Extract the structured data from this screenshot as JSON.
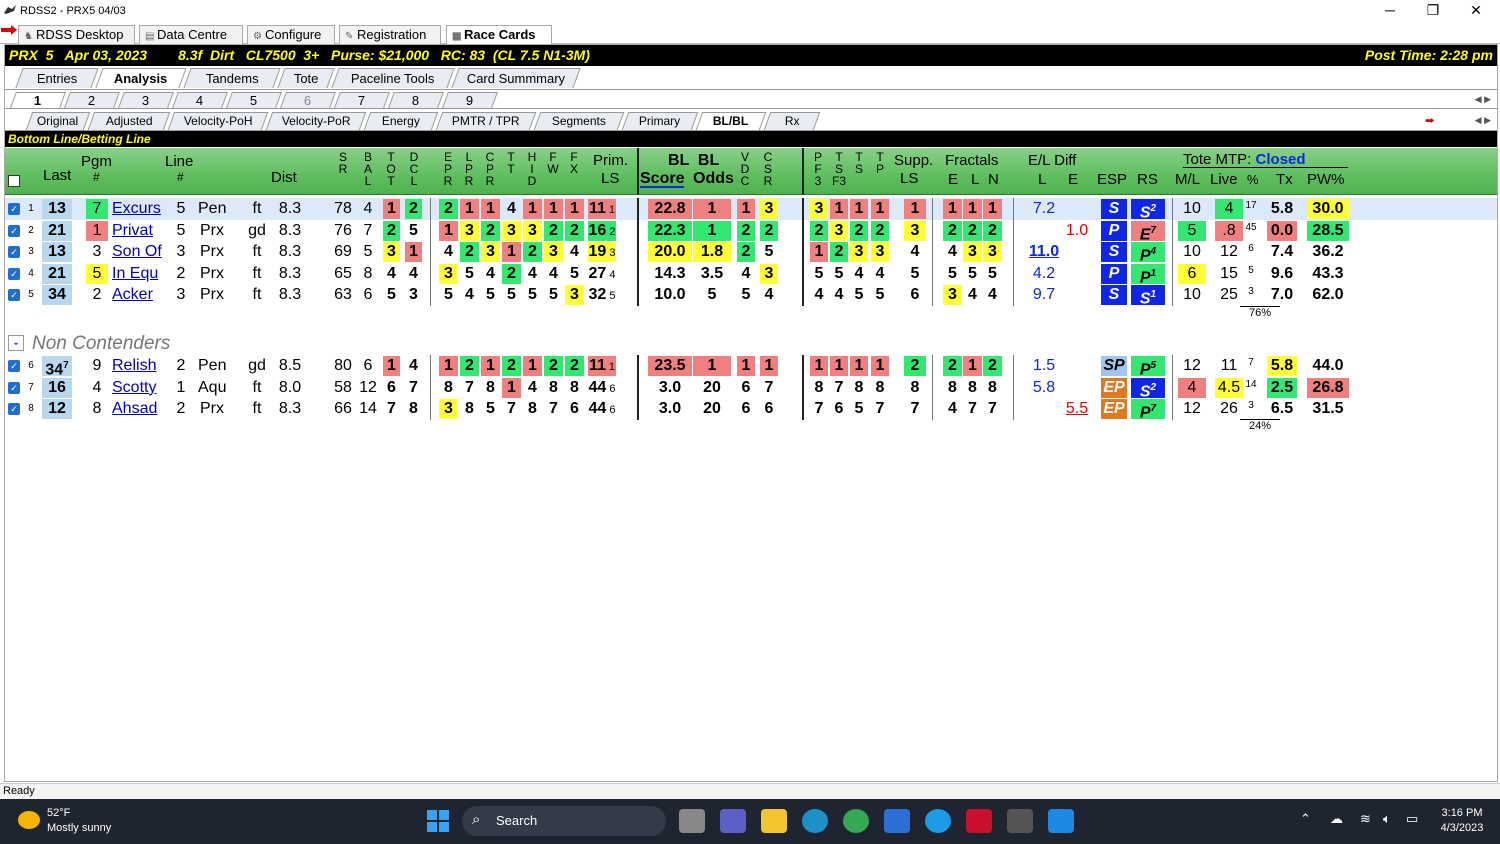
{
  "window": {
    "title": "RDSS2 - PRX5  04/03",
    "min": "─",
    "max": "❐",
    "close": "✕"
  },
  "app_tabs": [
    {
      "label": "RDSS Desktop"
    },
    {
      "label": "Data Centre"
    },
    {
      "label": "Configure"
    },
    {
      "label": "Registration"
    },
    {
      "label": "Race Cards"
    }
  ],
  "race": {
    "info": "PRX  5   Apr 03, 2023        8.3f  Dirt   CL7500  3+   Purse: $21,000   RC: 83  (CL 7.5 N1-3M)",
    "post_time": "Post Time: 2:28 pm"
  },
  "view_tabs": [
    "Entries",
    "Analysis",
    "Tandems",
    "Tote",
    "Paceline Tools",
    "Card Summmary"
  ],
  "race_tabs": [
    "1",
    "2",
    "3",
    "4",
    "5",
    "6",
    "7",
    "8",
    "9"
  ],
  "sub_tabs": [
    "Original",
    "Adjusted",
    "Velocity-PoH",
    "Velocity-PoR",
    "Energy",
    "PMTR / TPR",
    "Segments",
    "Primary",
    "BL/BL",
    "Rx"
  ],
  "section_title": "Bottom Line/Betting Line",
  "headers": {
    "last": "Last",
    "pgm": "Pgm",
    "pgm2": "#",
    "line": "Line",
    "line2": "#",
    "dist": "Dist",
    "prim": "Prim.",
    "ls": "LS",
    "bl": "BL  BL",
    "score": "Score",
    "odds": "Odds",
    "supp": "Supp.",
    "supp_ls": "LS",
    "fractals": "Fractals",
    "e": "E",
    "l": "L",
    "n": "N",
    "eldiff": "E/L Diff",
    "el_l": "L",
    "el_e": "E",
    "esp": "ESP",
    "rs": "RS",
    "tote": "Tote MTP:",
    "tote_status": "Closed",
    "ml": "M/L",
    "live": "Live",
    "pct": "%",
    "tx": "Tx",
    "pw": "PW%"
  },
  "contenders": [
    {
      "n": "1",
      "last": "13",
      "pgm": "7",
      "name": "Excurs",
      "line": "5",
      "trk": "Pen",
      "cond": "ft",
      "dist": "8.3",
      "sr": "78",
      "bal": "4",
      "tot": "1",
      "dcl": "2",
      "epr": "2",
      "lpr": "1",
      "cpr": "1",
      "tt": "4",
      "hid": "1",
      "fw": "1",
      "fx": "1",
      "prim": "11",
      "prim_s": "1",
      "score": "22.8",
      "odds": "1",
      "vdc": "1",
      "csr": "3",
      "pf3": "3",
      "tsf3": "1",
      "ts": "1",
      "tp": "1",
      "supp": "1",
      "fe": "1",
      "fl": "1",
      "fn": "1",
      "dl": "7.2",
      "de": "",
      "esp": "S",
      "rs": "S",
      "rs_s": "2",
      "ml": "10",
      "live": "4",
      "pct": "17",
      "tx": "5.8",
      "pw": "30.0"
    },
    {
      "n": "2",
      "last": "21",
      "pgm": "1",
      "name": "Privat",
      "line": "5",
      "trk": "Prx",
      "cond": "gd",
      "dist": "8.3",
      "sr": "76",
      "bal": "7",
      "tot": "2",
      "dcl": "5",
      "epr": "1",
      "lpr": "3",
      "cpr": "2",
      "tt": "3",
      "hid": "3",
      "fw": "2",
      "fx": "2",
      "prim": "16",
      "prim_s": "2",
      "score": "22.3",
      "odds": "1",
      "vdc": "2",
      "csr": "2",
      "pf3": "2",
      "tsf3": "3",
      "ts": "2",
      "tp": "2",
      "supp": "3",
      "fe": "2",
      "fl": "2",
      "fn": "2",
      "dl": "",
      "de": "1.0",
      "esp": "P",
      "rs": "E",
      "rs_s": "7",
      "ml": "5",
      "live": ".8",
      "pct": "45",
      "tx": "0.0",
      "pw": "28.5"
    },
    {
      "n": "3",
      "last": "13",
      "pgm": "3",
      "name": "Son Of",
      "line": "3",
      "trk": "Prx",
      "cond": "ft",
      "dist": "8.3",
      "sr": "69",
      "bal": "5",
      "tot": "3",
      "dcl": "1",
      "epr": "4",
      "lpr": "2",
      "cpr": "3",
      "tt": "1",
      "hid": "2",
      "fw": "3",
      "fx": "4",
      "prim": "19",
      "prim_s": "3",
      "score": "20.0",
      "odds": "1.8",
      "vdc": "2",
      "csr": "5",
      "pf3": "1",
      "tsf3": "2",
      "ts": "3",
      "tp": "3",
      "supp": "4",
      "fe": "4",
      "fl": "3",
      "fn": "3",
      "dl": "11.0",
      "de": "",
      "esp": "S",
      "rs": "P",
      "rs_s": "4",
      "ml": "10",
      "live": "12",
      "pct": "6",
      "tx": "7.4",
      "pw": "36.2"
    },
    {
      "n": "4",
      "last": "21",
      "pgm": "5",
      "name": "In Equ",
      "line": "2",
      "trk": "Prx",
      "cond": "ft",
      "dist": "8.3",
      "sr": "65",
      "bal": "8",
      "tot": "4",
      "dcl": "4",
      "epr": "3",
      "lpr": "5",
      "cpr": "4",
      "tt": "2",
      "hid": "4",
      "fw": "4",
      "fx": "5",
      "prim": "27",
      "prim_s": "4",
      "score": "14.3",
      "odds": "3.5",
      "vdc": "4",
      "csr": "3",
      "pf3": "5",
      "tsf3": "5",
      "ts": "4",
      "tp": "4",
      "supp": "5",
      "fe": "5",
      "fl": "5",
      "fn": "5",
      "dl": "4.2",
      "de": "",
      "esp": "P",
      "rs": "P",
      "rs_s": "1",
      "ml": "6",
      "live": "15",
      "pct": "5",
      "tx": "9.6",
      "pw": "43.3"
    },
    {
      "n": "5",
      "last": "34",
      "pgm": "2",
      "name": "Acker",
      "line": "3",
      "trk": "Prx",
      "cond": "ft",
      "dist": "8.3",
      "sr": "63",
      "bal": "6",
      "tot": "5",
      "dcl": "3",
      "epr": "5",
      "lpr": "4",
      "cpr": "5",
      "tt": "5",
      "hid": "5",
      "fw": "5",
      "fx": "3",
      "prim": "32",
      "prim_s": "5",
      "score": "10.0",
      "odds": "5",
      "vdc": "5",
      "csr": "4",
      "pf3": "4",
      "tsf3": "4",
      "ts": "5",
      "tp": "5",
      "supp": "6",
      "fe": "3",
      "fl": "4",
      "fn": "4",
      "dl": "9.7",
      "de": "",
      "esp": "S",
      "rs": "S",
      "rs_s": "1",
      "ml": "10",
      "live": "25",
      "pct": "3",
      "tx": "7.0",
      "pw": "62.0"
    }
  ],
  "contenders_total": "76%",
  "non_contenders_label": "Non Contenders",
  "non_contenders_btn": "-",
  "non_contenders": [
    {
      "n": "6",
      "last": "34",
      "last_s": "7",
      "pgm": "9",
      "name": "Relish",
      "line": "2",
      "trk": "Pen",
      "cond": "gd",
      "dist": "8.5",
      "sr": "80",
      "bal": "6",
      "tot": "1",
      "dcl": "4",
      "epr": "1",
      "lpr": "2",
      "cpr": "1",
      "tt": "2",
      "hid": "1",
      "fw": "2",
      "fx": "2",
      "prim": "11",
      "prim_s": "1",
      "score": "23.5",
      "odds": "1",
      "vdc": "1",
      "csr": "1",
      "pf3": "1",
      "tsf3": "1",
      "ts": "1",
      "tp": "1",
      "supp": "2",
      "fe": "2",
      "fl": "1",
      "fn": "2",
      "dl": "1.5",
      "de": "",
      "esp": "SP",
      "rs": "P",
      "rs_s": "5",
      "ml": "12",
      "live": "11",
      "pct": "7",
      "tx": "5.8",
      "pw": "44.0"
    },
    {
      "n": "7",
      "last": "16",
      "last_s": "",
      "pgm": "4",
      "name": "Scotty",
      "line": "1",
      "trk": "Aqu",
      "cond": "ft",
      "dist": "8.0",
      "sr": "58",
      "bal": "12",
      "tot": "6",
      "dcl": "7",
      "epr": "8",
      "lpr": "7",
      "cpr": "8",
      "tt": "1",
      "hid": "4",
      "fw": "8",
      "fx": "8",
      "prim": "44",
      "prim_s": "6",
      "score": "3.0",
      "odds": "20",
      "vdc": "6",
      "csr": "7",
      "pf3": "8",
      "tsf3": "7",
      "ts": "8",
      "tp": "8",
      "supp": "8",
      "fe": "8",
      "fl": "8",
      "fn": "8",
      "dl": "5.8",
      "de": "",
      "esp": "EP",
      "rs": "S",
      "rs_s": "2",
      "ml": "4",
      "live": "4.5",
      "pct": "14",
      "tx": "2.5",
      "pw": "26.8"
    },
    {
      "n": "8",
      "last": "12",
      "last_s": "",
      "pgm": "8",
      "name": "Ahsad",
      "line": "2",
      "trk": "Prx",
      "cond": "ft",
      "dist": "8.3",
      "sr": "66",
      "bal": "14",
      "tot": "7",
      "dcl": "8",
      "epr": "3",
      "lpr": "8",
      "cpr": "5",
      "tt": "7",
      "hid": "8",
      "fw": "7",
      "fx": "6",
      "prim": "44",
      "prim_s": "6",
      "score": "3.0",
      "odds": "20",
      "vdc": "6",
      "csr": "6",
      "pf3": "7",
      "tsf3": "6",
      "ts": "5",
      "tp": "7",
      "supp": "7",
      "fe": "4",
      "fl": "7",
      "fn": "7",
      "dl": "",
      "de": "5.5",
      "esp": "EP",
      "rs": "P",
      "rs_s": "7",
      "ml": "12",
      "live": "26",
      "pct": "3",
      "tx": "6.5",
      "pw": "31.5"
    }
  ],
  "non_contenders_total": "24%",
  "status": "Ready",
  "taskbar": {
    "temp": "52°F",
    "weather": "Mostly sunny",
    "search": "Search",
    "time": "3:16 PM",
    "date": "4/3/2023"
  }
}
